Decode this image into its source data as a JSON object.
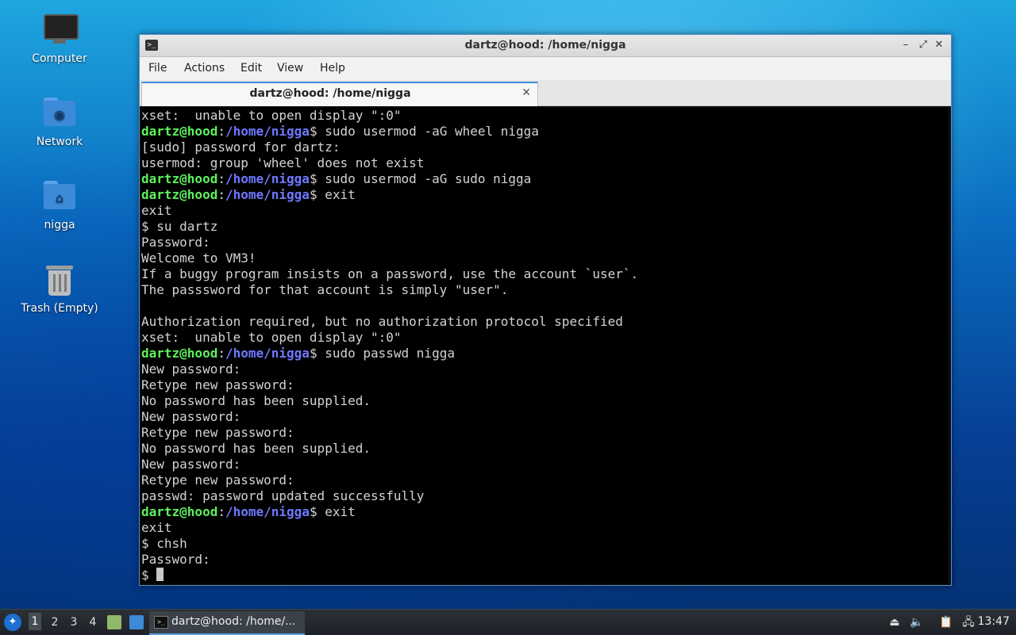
{
  "desktop": {
    "icons": [
      {
        "label": "Computer",
        "icon": "computer-icon"
      },
      {
        "label": "Network",
        "icon": "network-folder-icon"
      },
      {
        "label": "nigga",
        "icon": "home-folder-icon"
      },
      {
        "label": "Trash (Empty)",
        "icon": "trash-icon"
      }
    ]
  },
  "window": {
    "title": "dartz@hood: /home/nigga",
    "controls": {
      "minimize": "–",
      "maximize": "⤢",
      "close": "✕"
    },
    "menu": [
      "File",
      "Actions",
      "Edit",
      "View",
      "Help"
    ],
    "tab": {
      "label": "dartz@hood: /home/nigga",
      "close": "✕"
    }
  },
  "terminal": {
    "prompt_user": "dartz@hood",
    "prompt_sep": ":",
    "prompt_path": "/home/nigga",
    "prompt_end": "$ ",
    "lines": [
      {
        "kind": "out",
        "text": "xset:  unable to open display \":0\""
      },
      {
        "kind": "prompt",
        "text": "sudo usermod -aG wheel nigga"
      },
      {
        "kind": "out",
        "text": "[sudo] password for dartz:"
      },
      {
        "kind": "out",
        "text": "usermod: group 'wheel' does not exist"
      },
      {
        "kind": "prompt",
        "text": "sudo usermod -aG sudo nigga"
      },
      {
        "kind": "prompt",
        "text": "exit"
      },
      {
        "kind": "out",
        "text": "exit"
      },
      {
        "kind": "out",
        "text": "$ su dartz"
      },
      {
        "kind": "out",
        "text": "Password:"
      },
      {
        "kind": "out",
        "text": "Welcome to VM3!"
      },
      {
        "kind": "out",
        "text": "If a buggy program insists on a password, use the account `user`."
      },
      {
        "kind": "out",
        "text": "The passsword for that account is simply \"user\"."
      },
      {
        "kind": "out",
        "text": ""
      },
      {
        "kind": "out",
        "text": "Authorization required, but no authorization protocol specified"
      },
      {
        "kind": "out",
        "text": "xset:  unable to open display \":0\""
      },
      {
        "kind": "prompt",
        "text": "sudo passwd nigga"
      },
      {
        "kind": "out",
        "text": "New password:"
      },
      {
        "kind": "out",
        "text": "Retype new password:"
      },
      {
        "kind": "out",
        "text": "No password has been supplied."
      },
      {
        "kind": "out",
        "text": "New password:"
      },
      {
        "kind": "out",
        "text": "Retype new password:"
      },
      {
        "kind": "out",
        "text": "No password has been supplied."
      },
      {
        "kind": "out",
        "text": "New password:"
      },
      {
        "kind": "out",
        "text": "Retype new password:"
      },
      {
        "kind": "out",
        "text": "passwd: password updated successfully"
      },
      {
        "kind": "prompt",
        "text": "exit"
      },
      {
        "kind": "out",
        "text": "exit"
      },
      {
        "kind": "out",
        "text": "$ chsh"
      },
      {
        "kind": "out",
        "text": "Password:"
      }
    ],
    "last_line": "$ "
  },
  "taskbar": {
    "workspaces": [
      "1",
      "2",
      "3",
      "4"
    ],
    "active_workspace": "1",
    "task_label": "dartz@hood: /home/...",
    "clock": "13:47"
  }
}
